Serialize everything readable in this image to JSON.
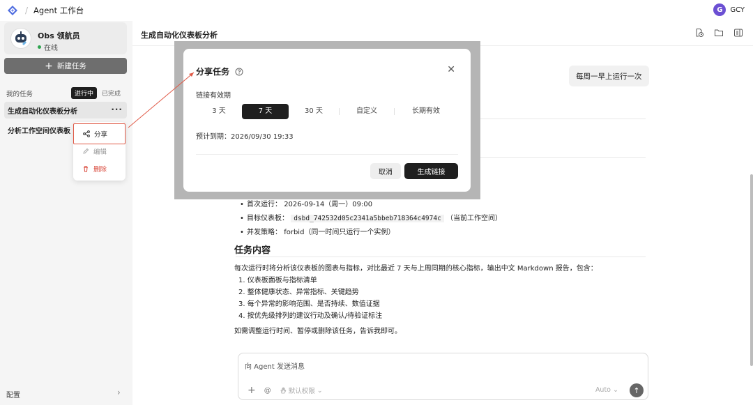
{
  "topbar": {
    "title": "Agent 工作台",
    "user_initial": "G",
    "user_name": "GCY"
  },
  "sidebar": {
    "agent_name": "Obs 领航员",
    "agent_status": "在线",
    "new_task_label": "新建任务",
    "my_tasks_label": "我的任务",
    "filter_in_progress": "进行中",
    "filter_done": "已完成",
    "tasks": [
      "生成自动化仪表板分析",
      "分析工作空间仪表板"
    ],
    "menu": {
      "share": "分享",
      "edit": "编辑",
      "delete": "删除"
    },
    "config_label": "配置"
  },
  "main": {
    "title": "生成自动化仪表板分析",
    "user_message": "每周一早上运行一次",
    "bullets": {
      "first_run_label": "首次运行：",
      "first_run_value": "2026-09-14（周一）09:00",
      "target_label": "目标仪表板：",
      "target_id": "dsbd_742532d05c2341a5bbeb718364c4974c",
      "target_note": "（当前工作空间）",
      "concurrency_label": "并发策略：",
      "concurrency_value": "forbid（同一时间只运行一个实例）"
    },
    "section_title": "任务内容",
    "paragraph": "每次运行时将分析该仪表板的图表与指标，对比最近 7 天与上周同期的核心指标，输出中文 Markdown 报告，包含：",
    "list": [
      "1. 仪表板面板与指标清单",
      "2. 整体健康状态、异常指标、关键趋势",
      "3. 每个异常的影响范围、是否持续、数值证据",
      "4. 按优先级排列的建议行动及确认/待验证标注"
    ],
    "closing": "如需调整运行时间、暂停或删除该任务，告诉我即可。"
  },
  "composer": {
    "placeholder": "向 Agent 发送消息",
    "permission": "默认权限",
    "mode": "Auto"
  },
  "modal": {
    "title": "分享任务",
    "label": "链接有效期",
    "options": [
      "3 天",
      "7 天",
      "30 天",
      "自定义",
      "长期有效"
    ],
    "selected_index": 1,
    "expire_text": "预计到期：2026/09/30 19:33",
    "cancel": "取消",
    "generate": "生成链接"
  },
  "colors": {
    "annotation": "#e05a47",
    "dark": "#1f1f1f",
    "logo": "#4f6de0"
  }
}
